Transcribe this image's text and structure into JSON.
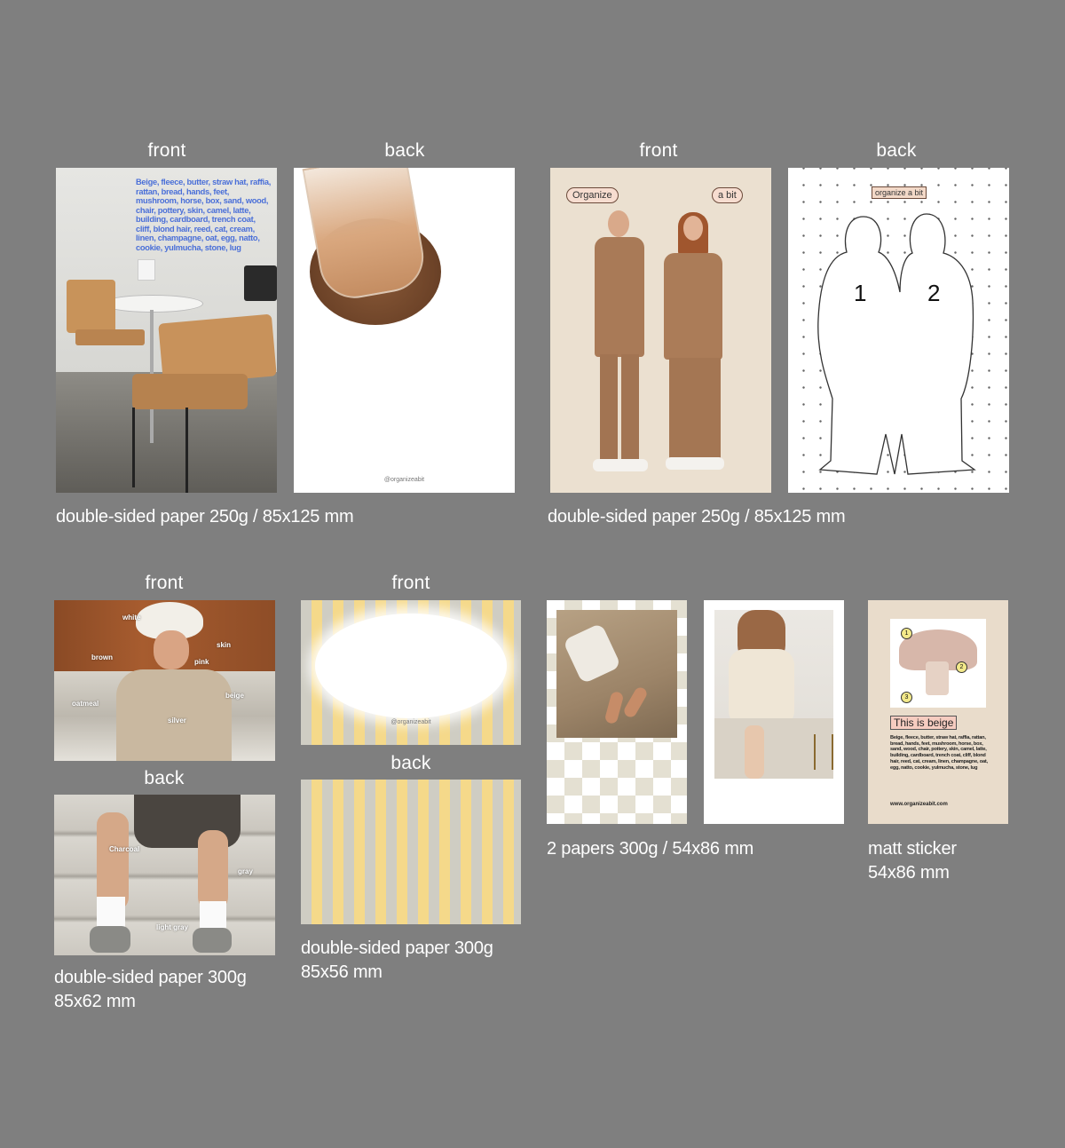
{
  "row1": {
    "left": {
      "front_label": "front",
      "back_label": "back",
      "front_text": "Beige, fleece, butter, straw hat, raffia, rattan, bread, hands, feet, mushroom, horse, box, sand, wood, chair, pottery, skin, camel, latte, building, cardboard, trench coat, cliff, blond hair, reed, cat, cream, linen, champagne, oat, egg, natto, cookie, yulmucha, stone, lug",
      "back_handle": "@organizeabit",
      "caption": "double-sided paper 250g / 85x125 mm"
    },
    "right": {
      "front_label": "front",
      "back_label": "back",
      "bubble_left": "Organize",
      "bubble_right": "a bit",
      "back_tag": "organize a bit",
      "num1": "1",
      "num2": "2",
      "caption": "double-sided paper 250g / 85x125 mm"
    }
  },
  "row2": {
    "man": {
      "front_label": "front",
      "back_label": "back",
      "front_words": [
        "white",
        "brown",
        "skin",
        "pink",
        "oatmeal",
        "beige",
        "silver"
      ],
      "back_words": [
        "Charcoal",
        "gray",
        "light gray"
      ],
      "caption_line1": "double-sided paper 300g",
      "caption_line2": "85x62 mm"
    },
    "stripes": {
      "front_label": "front",
      "back_label": "back",
      "front_handle": "@organizeabit",
      "caption_line1": "double-sided paper 300g",
      "caption_line2": "85x56 mm"
    },
    "papers": {
      "caption": "2 papers 300g / 54x86 mm"
    },
    "sticker": {
      "nums": [
        "1",
        "2",
        "3"
      ],
      "title": "This is beige",
      "text": "Beige, fleece, butter, straw hat, raffia, rattan, bread, hands, feet, mushroom, horse, box, sand, wood, chair, pottery, skin, camel, latte, building, cardboard, trench coat, cliff, blond hair, reed, cat, cream, linen, champagne, oat, egg, natto, cookie, yulmucha, stone, lug",
      "url": "www.organizeabit.com",
      "caption_line1": "matt sticker",
      "caption_line2": "54x86 mm"
    }
  },
  "colors": {
    "background": "#7f7f7f",
    "beige_card": "#ebe0d0",
    "text_blue": "#4a6fd8",
    "stripe_yellow": "#f5d98a",
    "stripe_gray": "#cfcdc3"
  }
}
